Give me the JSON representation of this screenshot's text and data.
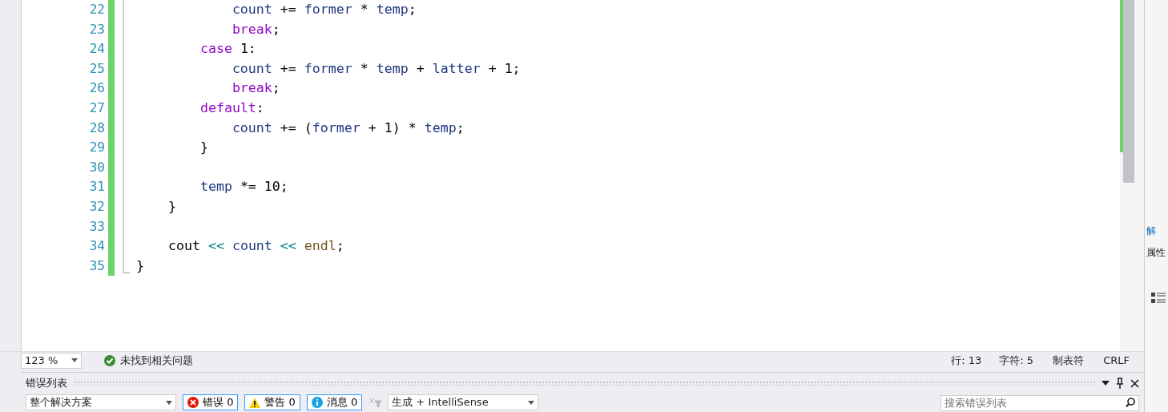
{
  "editor": {
    "lines": [
      {
        "number": "22",
        "tokens": [
          {
            "text": "            count",
            "kind": "var"
          },
          {
            "text": " += ",
            "kind": "plain"
          },
          {
            "text": "former",
            "kind": "var"
          },
          {
            "text": " * ",
            "kind": "plain"
          },
          {
            "text": "temp",
            "kind": "var"
          },
          {
            "text": ";",
            "kind": "plain"
          }
        ]
      },
      {
        "number": "23",
        "tokens": [
          {
            "text": "            break",
            "kind": "keyword"
          },
          {
            "text": ";",
            "kind": "plain"
          }
        ]
      },
      {
        "number": "24",
        "tokens": [
          {
            "text": "        case",
            "kind": "keyword"
          },
          {
            "text": " 1:",
            "kind": "plain"
          }
        ]
      },
      {
        "number": "25",
        "tokens": [
          {
            "text": "            count",
            "kind": "var"
          },
          {
            "text": " += ",
            "kind": "plain"
          },
          {
            "text": "former",
            "kind": "var"
          },
          {
            "text": " * ",
            "kind": "plain"
          },
          {
            "text": "temp",
            "kind": "var"
          },
          {
            "text": " + ",
            "kind": "plain"
          },
          {
            "text": "latter",
            "kind": "var"
          },
          {
            "text": " + 1;",
            "kind": "plain"
          }
        ]
      },
      {
        "number": "26",
        "tokens": [
          {
            "text": "            break",
            "kind": "keyword"
          },
          {
            "text": ";",
            "kind": "plain"
          }
        ]
      },
      {
        "number": "27",
        "tokens": [
          {
            "text": "        default",
            "kind": "keyword"
          },
          {
            "text": ":",
            "kind": "plain"
          }
        ]
      },
      {
        "number": "28",
        "tokens": [
          {
            "text": "            count",
            "kind": "var"
          },
          {
            "text": " += (",
            "kind": "plain"
          },
          {
            "text": "former",
            "kind": "var"
          },
          {
            "text": " + 1) * ",
            "kind": "plain"
          },
          {
            "text": "temp",
            "kind": "var"
          },
          {
            "text": ";",
            "kind": "plain"
          }
        ]
      },
      {
        "number": "29",
        "tokens": [
          {
            "text": "        }",
            "kind": "plain"
          }
        ]
      },
      {
        "number": "30"
      },
      {
        "number": "31",
        "tokens": [
          {
            "text": "        temp",
            "kind": "var"
          },
          {
            "text": " *= 10;",
            "kind": "plain"
          }
        ]
      },
      {
        "number": "32",
        "tokens": [
          {
            "text": "    }",
            "kind": "plain"
          }
        ]
      },
      {
        "number": "33"
      },
      {
        "number": "34",
        "tokens": [
          {
            "text": "    cout ",
            "kind": "plain"
          },
          {
            "text": "<<",
            "kind": "operator"
          },
          {
            "text": " count",
            "kind": "var"
          },
          {
            "text": " <<",
            "kind": "operator"
          },
          {
            "text": " endl",
            "kind": "function"
          },
          {
            "text": ";",
            "kind": "plain"
          }
        ]
      },
      {
        "number": "35",
        "tokens": [
          {
            "text": "}",
            "kind": "plain"
          }
        ]
      }
    ]
  },
  "status_bar": {
    "zoom": "123 %",
    "issues": "未找到相关问题",
    "line": "行: 13",
    "char": "字符: 5",
    "indent": "制表符",
    "eol": "CRLF"
  },
  "error_list": {
    "title": "错误列表",
    "scope": "整个解决方案",
    "filters": [
      {
        "kind": "error",
        "label": "错误 0",
        "selected": true
      },
      {
        "kind": "warning",
        "label": "警告 0",
        "selected": true
      },
      {
        "kind": "info",
        "label": "消息 0",
        "selected": true
      }
    ],
    "clear_filter_disabled": true,
    "source": "生成 + IntelliSense",
    "search": {
      "placeholder": "搜索错误列表"
    }
  },
  "side_panels": [
    {
      "kind": "link",
      "label": "解"
    },
    {
      "kind": "tab",
      "label": "属性"
    }
  ]
}
